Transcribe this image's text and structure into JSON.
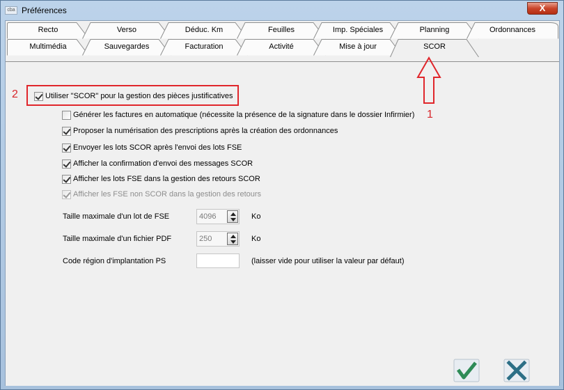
{
  "window": {
    "title": "Préférences",
    "app_icon_text": "cba",
    "close_label": "X"
  },
  "tabs_row1": [
    "Recto",
    "Verso",
    "Déduc. Km",
    "Feuilles",
    "Imp. Spéciales",
    "Planning",
    "Ordonnances"
  ],
  "tabs_row2": [
    "Multimédia",
    "Sauvegardes",
    "Facturation",
    "Activité",
    "Mise à jour",
    "SCOR"
  ],
  "active_tab": "SCOR",
  "options": {
    "main": {
      "label": "Utiliser \"SCOR\" pour la gestion des pièces justificatives",
      "checked": true
    },
    "sub": [
      {
        "label": "Générer les factures en automatique (nécessite la présence de la signature dans le dossier Infirmier)",
        "checked": false,
        "disabled": false
      },
      {
        "label": "Proposer la numérisation des prescriptions après la création des ordonnances",
        "checked": true,
        "disabled": false
      },
      {
        "label": "Envoyer les lots SCOR après l'envoi des lots FSE",
        "checked": true,
        "disabled": false
      },
      {
        "label": "Afficher la confirmation d'envoi des messages SCOR",
        "checked": true,
        "disabled": false
      },
      {
        "label": "Afficher les lots FSE dans la gestion des retours SCOR",
        "checked": true,
        "disabled": false
      },
      {
        "label": "Afficher les FSE non SCOR dans la gestion des retours",
        "checked": true,
        "disabled": true
      }
    ]
  },
  "fields": {
    "lot_fse": {
      "label": "Taille maximale d'un lot de FSE",
      "value": "4096",
      "unit": "Ko"
    },
    "pdf": {
      "label": "Taille maximale d'un fichier PDF",
      "value": "250",
      "unit": "Ko"
    },
    "region": {
      "label": "Code région d'implantation PS",
      "value": "",
      "hint": "(laisser vide pour utiliser la valeur par défaut)"
    }
  },
  "annotations": {
    "n1": "1",
    "n2": "2"
  },
  "colors": {
    "annotation": "#e0262b",
    "confirm": "#2e8b57",
    "cancel": "#2c6f86"
  }
}
